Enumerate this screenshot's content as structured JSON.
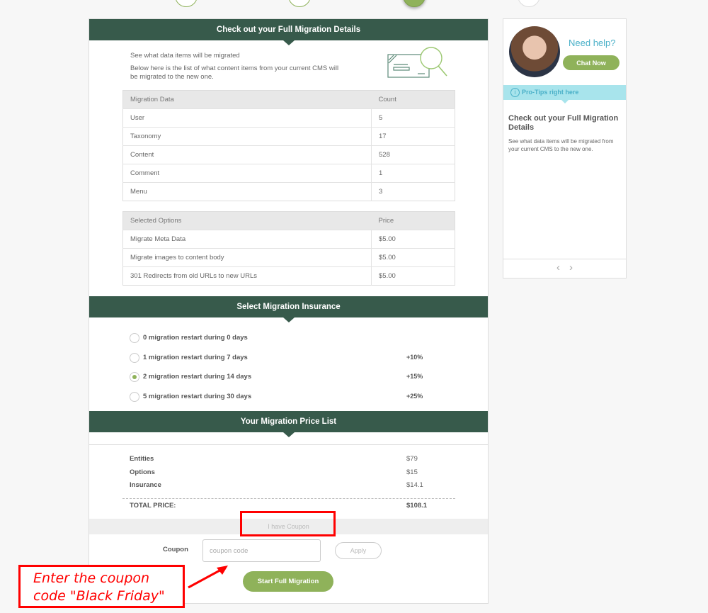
{
  "stepper": {
    "steps": [
      {
        "state": "done"
      },
      {
        "state": "done"
      },
      {
        "state": "active"
      },
      {
        "state": "pending"
      }
    ]
  },
  "details": {
    "header": "Check out your Full Migration Details",
    "intro_line1": "See what data items will be migrated",
    "intro_line2": "Below here is the list of what content items from your current CMS will be migrated to the new one.",
    "illustration_icon": "document-magnifier-icon",
    "migration_table": {
      "headers": [
        "Migration Data",
        "Count"
      ],
      "rows": [
        [
          "User",
          "5"
        ],
        [
          "Taxonomy",
          "17"
        ],
        [
          "Content",
          "528"
        ],
        [
          "Comment",
          "1"
        ],
        [
          "Menu",
          "3"
        ]
      ]
    },
    "options_table": {
      "headers": [
        "Selected Options",
        "Price"
      ],
      "rows": [
        [
          "Migrate Meta Data",
          "$5.00"
        ],
        [
          "Migrate images to content body",
          "$5.00"
        ],
        [
          "301 Redirects from old URLs to new URLs",
          "$5.00"
        ]
      ]
    }
  },
  "insurance": {
    "header": "Select Migration Insurance",
    "options": [
      {
        "label": "0 migration restart during 0 days",
        "pct": "",
        "checked": false
      },
      {
        "label": "1 migration restart during 7 days",
        "pct": "+10%",
        "checked": false
      },
      {
        "label": "2 migration restart during 14 days",
        "pct": "+15%",
        "checked": true
      },
      {
        "label": "5 migration restart during 30 days",
        "pct": "+25%",
        "checked": false
      }
    ]
  },
  "price_list": {
    "header": "Your Migration Price List",
    "rows": [
      {
        "label": "Entities",
        "value": "$79"
      },
      {
        "label": "Options",
        "value": "$15"
      },
      {
        "label": "Insurance",
        "value": "$14.1"
      }
    ],
    "total_label": "TOTAL PRICE:",
    "total_value": "$108.1"
  },
  "coupon": {
    "toggle_label": "I have Coupon",
    "field_label": "Coupon",
    "input_value": "",
    "placeholder": "coupon code",
    "apply_label": "Apply"
  },
  "start_button": "Start Full Migration",
  "sidebar": {
    "need_help": "Need help?",
    "chat_button": "Chat Now",
    "tips_label": "Pro-Tips right here",
    "tip_title": "Check out your Full Migration Details",
    "tip_body": "See what data items will be migrated from your current CMS to the new one.",
    "prev_icon": "‹",
    "next_icon": "›"
  },
  "annotation": {
    "text": "Enter the coupon code \"Black Friday\"",
    "color": "#ff0000"
  },
  "colors": {
    "header_green": "#375a4b",
    "accent_green": "#8fb25a",
    "tips_cyan": "#a8e4ec",
    "help_blue": "#4ab0c8"
  }
}
